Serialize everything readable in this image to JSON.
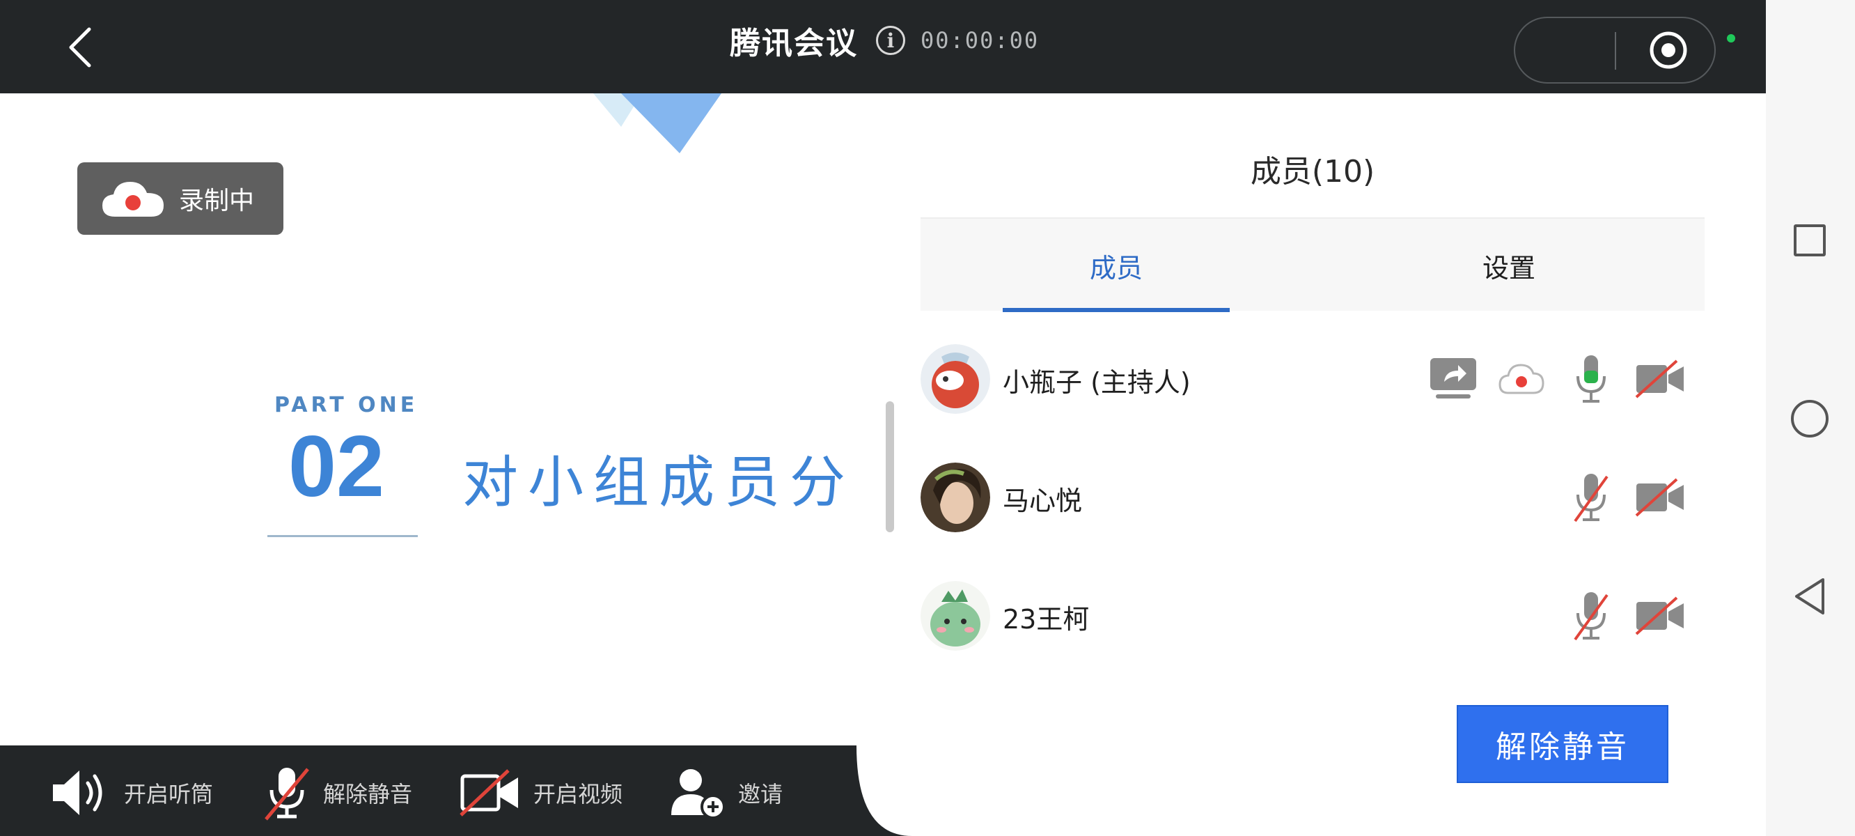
{
  "header": {
    "title": "腾讯会议",
    "timer": "00:00:00"
  },
  "recording_badge": {
    "label": "录制中"
  },
  "slide": {
    "part_label": "PART ONE",
    "part_number": "02",
    "heading": "对小组成员分"
  },
  "toolbar": {
    "speaker_label": "开启听筒",
    "mic_label": "解除静音",
    "video_label": "开启视频",
    "invite_label": "邀请"
  },
  "panel": {
    "title": "成员(10)",
    "tabs": [
      {
        "label": "成员",
        "active": true
      },
      {
        "label": "设置",
        "active": false
      }
    ],
    "members": [
      {
        "name": "小瓶子 (主持人)",
        "sharing": true,
        "recording": true,
        "mic_on": true,
        "video_on": false
      },
      {
        "name": "马心悦",
        "sharing": false,
        "recording": false,
        "mic_on": false,
        "video_on": false
      },
      {
        "name": "23王柯",
        "sharing": false,
        "recording": false,
        "mic_on": false,
        "video_on": false
      }
    ],
    "unmute_button": "解除静音"
  },
  "colors": {
    "accent": "#2f70ee",
    "slide_blue": "#3d84d6",
    "bar_dark": "#232628",
    "mic_active": "#2bb24c",
    "muted_slash": "#e0443a",
    "record_red": "#e8403a"
  },
  "icons": [
    "back-chevron-icon",
    "info-icon",
    "target-icon",
    "speaker-icon",
    "mic-muted-icon",
    "video-off-icon",
    "add-user-icon",
    "screen-share-icon",
    "cloud-record-icon",
    "mic-icon",
    "square-icon",
    "circle-icon",
    "triangle-back-icon"
  ]
}
